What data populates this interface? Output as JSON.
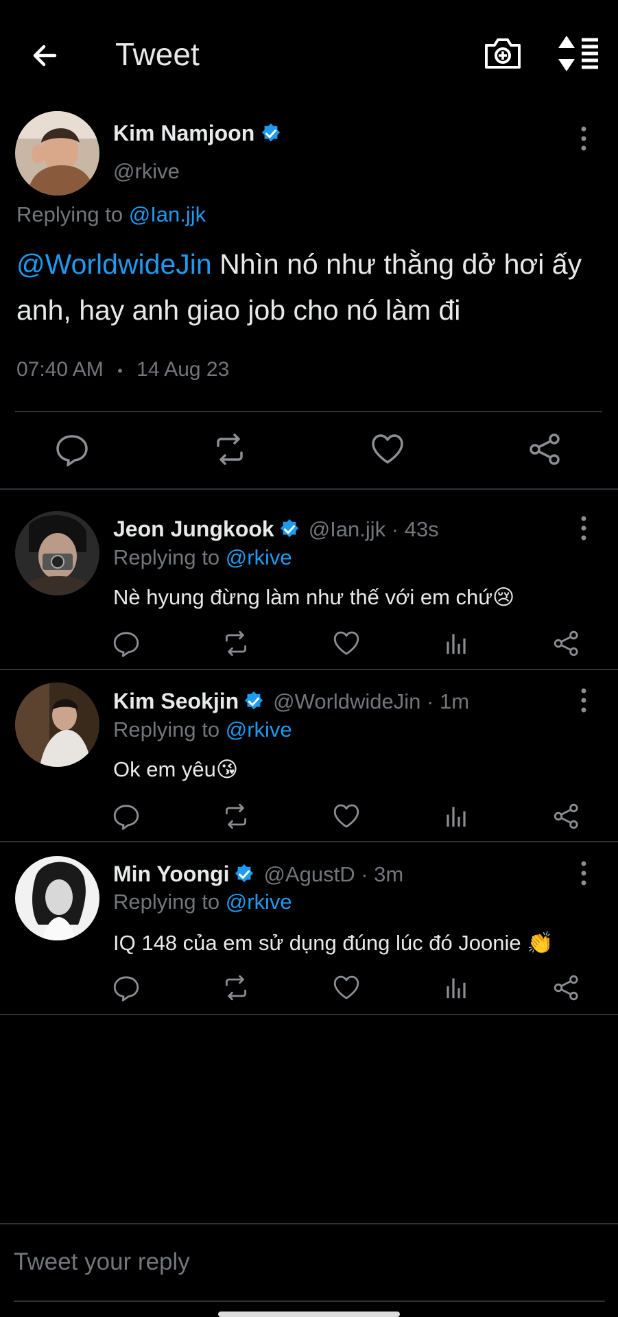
{
  "header": {
    "title": "Tweet"
  },
  "main_tweet": {
    "name": "Kim Namjoon",
    "handle": "@rkive",
    "replying_label": "Replying to",
    "replying_to": "@Ian.jjk",
    "mention": "@WorldwideJin",
    "text": " Nhìn nó như thằng dở hơi ấy anh, hay anh giao job cho nó làm đi",
    "time": "07:40 AM",
    "dot": "•",
    "date": "14 Aug 23"
  },
  "replies": [
    {
      "name": "Jeon Jungkook",
      "handle": "@Ian.jjk · 43s",
      "replying_label": "Replying to",
      "replying_to": "@rkive",
      "text": "Nè hyung đừng làm như thế với em chứ😢"
    },
    {
      "name": "Kim Seokjin",
      "handle": "@WorldwideJin · 1m",
      "replying_label": "Replying to",
      "replying_to": "@rkive",
      "text": "Ok em yêu😘"
    },
    {
      "name": "Min Yoongi",
      "handle": "@AgustD · 3m",
      "replying_label": "Replying to",
      "replying_to": "@rkive",
      "text": "IQ 148 của em sử dụng đúng lúc đó Joonie 👏"
    }
  ],
  "composer": {
    "placeholder": "Tweet your reply"
  },
  "colors": {
    "accent": "#1d9bf0",
    "muted": "#71767b",
    "background": "#000000"
  }
}
